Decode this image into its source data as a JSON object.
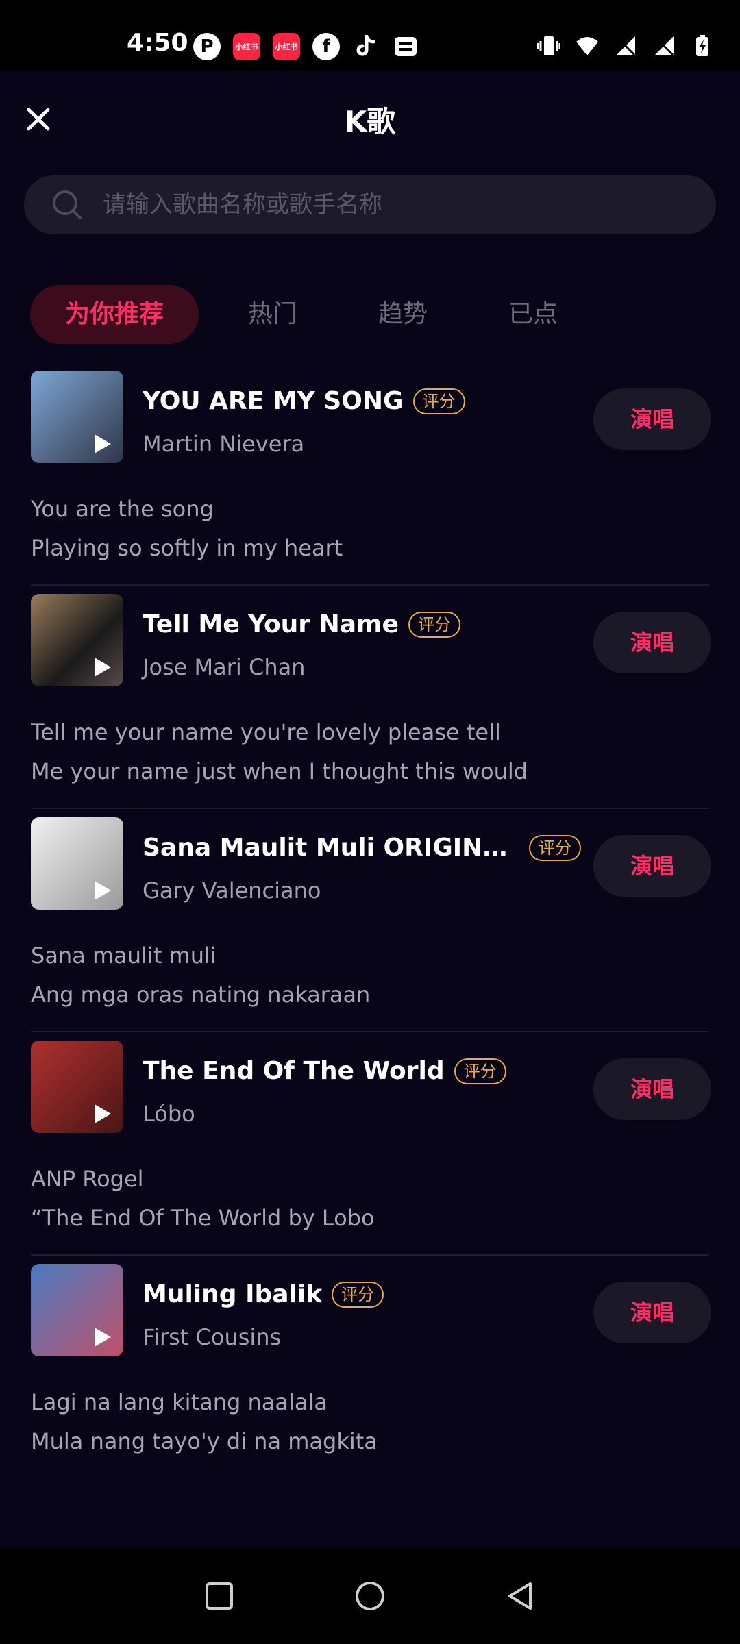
{
  "status_bar": {
    "time": "4:50",
    "left_icons": [
      "p-icon",
      "xiaohongshu-icon",
      "xiaohongshu-icon",
      "facebook-icon",
      "tiktok-icon",
      "wallet-icon"
    ],
    "xiaohongshu_label": "小红书",
    "right_icons": [
      "vibrate-icon",
      "wifi-icon",
      "signal-icon",
      "signal-icon",
      "battery-charging-icon"
    ]
  },
  "header": {
    "title": "K歌",
    "close_icon": "close-icon"
  },
  "search": {
    "placeholder": "请输入歌曲名称或歌手名称"
  },
  "tabs": [
    {
      "label": "为你推荐",
      "active": true
    },
    {
      "label": "热门",
      "active": false
    },
    {
      "label": "趋势",
      "active": false
    },
    {
      "label": "已点",
      "active": false
    }
  ],
  "songs": [
    {
      "title": "YOU ARE MY SONG",
      "badge": "评分",
      "artist": "Martin Nievera",
      "sing_label": "演唱",
      "lyric_1": "You are the song",
      "lyric_2": "Playing so softly in my heart",
      "cover_colors": [
        "#4a6a9a",
        "#2a2f3a"
      ]
    },
    {
      "title": "Tell Me Your Name",
      "badge": "评分",
      "artist": "Jose Mari Chan",
      "sing_label": "演唱",
      "lyric_1": "Tell me your name you're lovely please tell",
      "lyric_2": "Me your name just when I thought this would",
      "cover_colors": [
        "#6b5040",
        "#1a1a1a"
      ]
    },
    {
      "title": "Sana Maulit Muli ORIGINAL I...",
      "badge": "评分",
      "artist": "Gary Valenciano",
      "sing_label": "演唱",
      "lyric_1": "Sana maulit muli",
      "lyric_2": "Ang mga oras nating nakaraan",
      "cover_colors": [
        "#d8d8d8",
        "#8a8a8a"
      ]
    },
    {
      "title": "The End Of The World",
      "badge": "评分",
      "artist": "Lóbo",
      "sing_label": "演唱",
      "lyric_1": "ANP Rogel",
      "lyric_2": "“The End Of The World by Lobo",
      "cover_colors": [
        "#8a2020",
        "#3a1010"
      ]
    },
    {
      "title": "Muling Ibalik",
      "badge": "评分",
      "artist": "First Cousins",
      "sing_label": "演唱",
      "lyric_1": "Lagi na lang kitang naalala",
      "lyric_2": "Mula nang tayo'y di na magkita",
      "cover_colors": [
        "#3a6ab0",
        "#b04060"
      ]
    }
  ],
  "nav_bar": {
    "icons": [
      "recents-square-icon",
      "home-circle-icon",
      "back-triangle-icon"
    ]
  },
  "colors": {
    "accent": "#ff2f66",
    "badge": "#e9ab3c",
    "background": "#080518"
  }
}
